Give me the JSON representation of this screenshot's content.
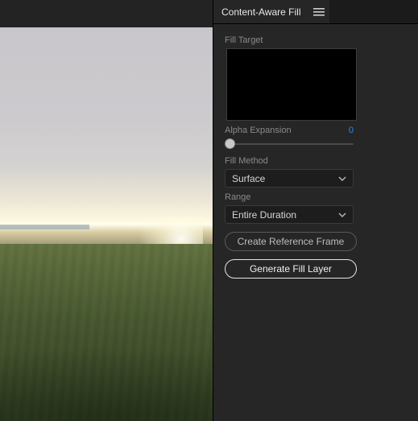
{
  "panel": {
    "title": "Content-Aware Fill",
    "fillTargetLabel": "Fill Target",
    "alphaExpansion": {
      "label": "Alpha Expansion",
      "value": "0"
    },
    "fillMethod": {
      "label": "Fill Method",
      "selected": "Surface"
    },
    "range": {
      "label": "Range",
      "selected": "Entire Duration"
    },
    "buttons": {
      "createRef": "Create Reference Frame",
      "generate": "Generate Fill Layer"
    }
  }
}
